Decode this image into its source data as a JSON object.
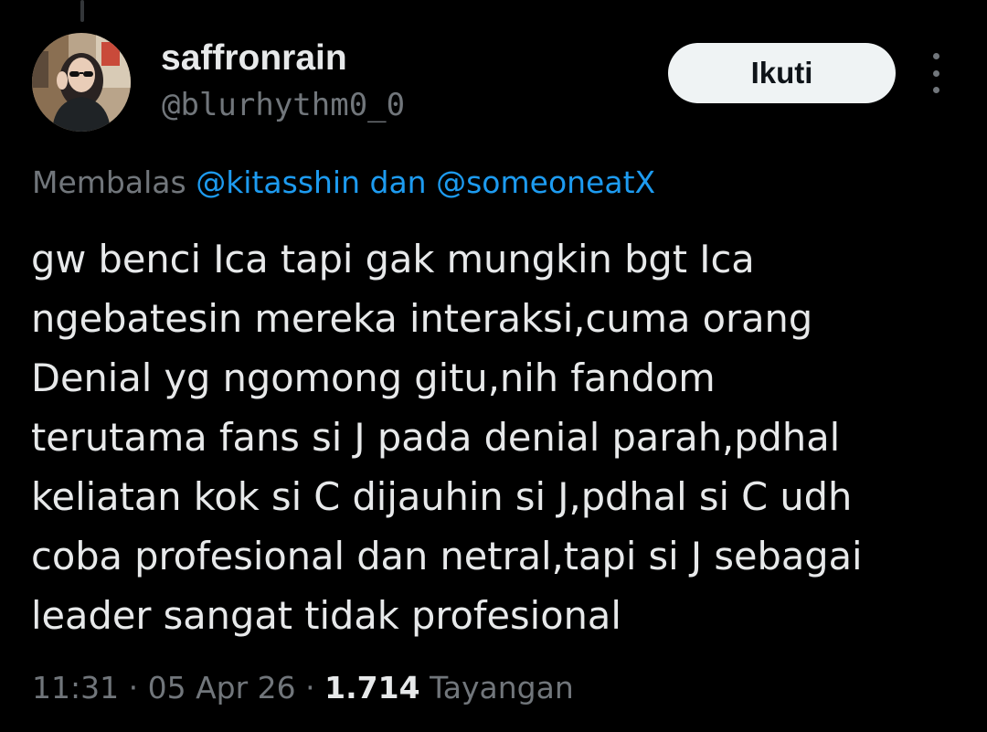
{
  "author": {
    "display_name": "saffronrain",
    "handle": "@blurhythm0_0",
    "avatar_icon": "user-avatar-photo"
  },
  "actions": {
    "follow_label": "Ikuti",
    "more_icon": "more-vertical-icon"
  },
  "reply": {
    "prefix": "Membalas",
    "mention_1": "@kitasshin",
    "conjunction": "dan",
    "mention_2": "@someoneatX"
  },
  "tweet": {
    "lines": [
      "gw benci Ica tapi gak mungkin bgt Ica",
      "ngebatesin mereka interaksi,cuma orang",
      "Denial yg ngomong gitu,nih fandom",
      "terutama fans si J pada denial parah,pdhal",
      "keliatan kok si C dijauhin si J,pdhal si C udh",
      "coba profesional dan netral,tapi si J sebagai",
      "leader sangat tidak profesional"
    ]
  },
  "meta": {
    "time": "11:31",
    "separator": "·",
    "date": "05 Apr 26",
    "views_count": "1.714",
    "views_label": "Tayangan"
  },
  "colors": {
    "background": "#000000",
    "text_primary": "#e7e9ea",
    "text_secondary": "#71767b",
    "accent": "#1d9bf0",
    "follow_button_bg": "#eff3f4"
  }
}
